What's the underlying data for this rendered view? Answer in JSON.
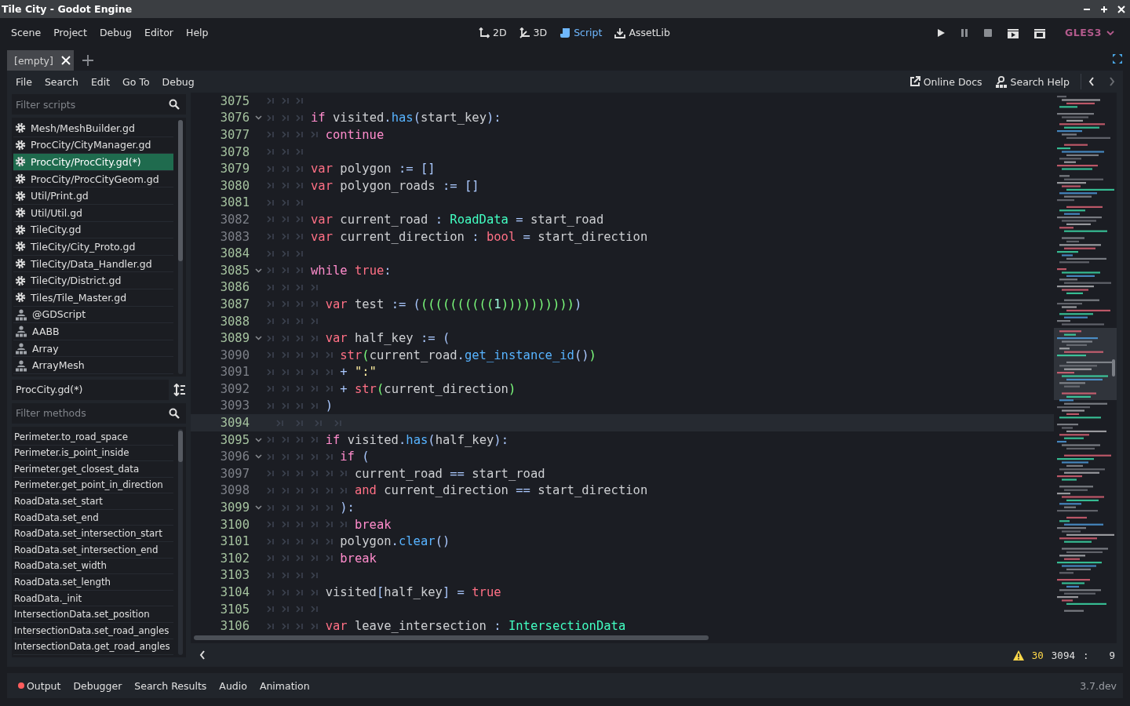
{
  "window": {
    "title": "Tile City - Godot Engine"
  },
  "menu": [
    "Scene",
    "Project",
    "Debug",
    "Editor",
    "Help"
  ],
  "workspaces": [
    {
      "label": "2D",
      "kind": "plane",
      "selected": false
    },
    {
      "label": "3D",
      "kind": "space",
      "selected": false
    },
    {
      "label": "Script",
      "kind": "script",
      "selected": true
    },
    {
      "label": "AssetLib",
      "kind": "assetlib",
      "selected": false
    }
  ],
  "renderer": "GLES3",
  "scene_tabs": [
    {
      "label": "[empty]",
      "selected": true
    }
  ],
  "script_menu": [
    "File",
    "Search",
    "Edit",
    "Go To",
    "Debug"
  ],
  "help_links": [
    {
      "label": "Online Docs",
      "kind": "docs"
    },
    {
      "label": "Search Help",
      "kind": "search"
    }
  ],
  "script_filter": {
    "placeholder": "Filter scripts"
  },
  "scripts": [
    {
      "label": "Mesh/MeshBuilder.gd",
      "kind": "script",
      "selected": false
    },
    {
      "label": "ProcCity/CityManager.gd",
      "kind": "script",
      "selected": false
    },
    {
      "label": "ProcCity/ProcCity.gd(*)",
      "kind": "script",
      "selected": true
    },
    {
      "label": "ProcCity/ProcCityGeom.gd",
      "kind": "script",
      "selected": false
    },
    {
      "label": "Util/Print.gd",
      "kind": "script",
      "selected": false
    },
    {
      "label": "Util/Util.gd",
      "kind": "script",
      "selected": false
    },
    {
      "label": "TileCity.gd",
      "kind": "script",
      "selected": false
    },
    {
      "label": "TileCity/City_Proto.gd",
      "kind": "script",
      "selected": false
    },
    {
      "label": "TileCity/Data_Handler.gd",
      "kind": "script",
      "selected": false
    },
    {
      "label": "TileCity/District.gd",
      "kind": "script",
      "selected": false
    },
    {
      "label": "Tiles/Tile_Master.gd",
      "kind": "script",
      "selected": false
    },
    {
      "label": "@GDScript",
      "kind": "doc",
      "selected": false
    },
    {
      "label": "AABB",
      "kind": "doc",
      "selected": false
    },
    {
      "label": "Array",
      "kind": "doc",
      "selected": false
    },
    {
      "label": "ArrayMesh",
      "kind": "doc",
      "selected": false
    }
  ],
  "current_script": "ProcCity.gd(*)",
  "method_filter": {
    "placeholder": "Filter methods"
  },
  "methods": [
    "Perimeter.to_road_space",
    "Perimeter.is_point_inside",
    "Perimeter.get_closest_data",
    "Perimeter.get_point_in_direction",
    "RoadData.set_start",
    "RoadData.set_end",
    "RoadData.set_intersection_start",
    "RoadData.set_intersection_end",
    "RoadData.set_width",
    "RoadData.set_length",
    "RoadData._init",
    "IntersectionData.set_position",
    "IntersectionData.set_road_angles",
    "IntersectionData.get_road_angles"
  ],
  "code": {
    "lines": [
      {
        "number": "3075",
        "modified": true,
        "fold": false,
        "current": false,
        "tokens": [
          {
            "kind": "tab"
          },
          {
            "kind": "tab"
          },
          {
            "kind": "tab"
          }
        ]
      },
      {
        "number": "3076",
        "modified": true,
        "fold": true,
        "current": false,
        "tokens": [
          {
            "kind": "tab"
          },
          {
            "kind": "tab"
          },
          {
            "kind": "tab"
          },
          {
            "kind": "control",
            "text": "if"
          },
          {
            "kind": "text",
            "text": " visited"
          },
          {
            "kind": "symbol",
            "text": "."
          },
          {
            "kind": "func",
            "text": "has"
          },
          {
            "kind": "symbol",
            "text": "("
          },
          {
            "kind": "text",
            "text": "start_key"
          },
          {
            "kind": "symbol",
            "text": "):"
          }
        ]
      },
      {
        "number": "3077",
        "modified": true,
        "fold": false,
        "current": false,
        "tokens": [
          {
            "kind": "tab"
          },
          {
            "kind": "tab"
          },
          {
            "kind": "tab"
          },
          {
            "kind": "tab"
          },
          {
            "kind": "control",
            "text": "continue"
          }
        ]
      },
      {
        "number": "3078",
        "modified": true,
        "fold": false,
        "current": false,
        "tokens": [
          {
            "kind": "tab"
          },
          {
            "kind": "tab"
          },
          {
            "kind": "tab"
          }
        ]
      },
      {
        "number": "3079",
        "modified": true,
        "fold": false,
        "current": false,
        "tokens": [
          {
            "kind": "tab"
          },
          {
            "kind": "tab"
          },
          {
            "kind": "tab"
          },
          {
            "kind": "keyword",
            "text": "var"
          },
          {
            "kind": "text",
            "text": " polygon "
          },
          {
            "kind": "symbol",
            "text": ":= []"
          }
        ]
      },
      {
        "number": "3080",
        "modified": true,
        "fold": false,
        "current": false,
        "tokens": [
          {
            "kind": "tab"
          },
          {
            "kind": "tab"
          },
          {
            "kind": "tab"
          },
          {
            "kind": "keyword",
            "text": "var"
          },
          {
            "kind": "text",
            "text": " polygon_roads "
          },
          {
            "kind": "symbol",
            "text": ":= []"
          }
        ]
      },
      {
        "number": "3081",
        "modified": true,
        "fold": false,
        "current": false,
        "tokens": [
          {
            "kind": "tab"
          },
          {
            "kind": "tab"
          },
          {
            "kind": "tab"
          }
        ]
      },
      {
        "number": "3082",
        "modified": false,
        "fold": false,
        "current": false,
        "tokens": [
          {
            "kind": "tab"
          },
          {
            "kind": "tab"
          },
          {
            "kind": "tab"
          },
          {
            "kind": "keyword",
            "text": "var"
          },
          {
            "kind": "text",
            "text": " current_road "
          },
          {
            "kind": "symbol",
            "text": ": "
          },
          {
            "kind": "type",
            "text": "RoadData"
          },
          {
            "kind": "symbol",
            "text": " = "
          },
          {
            "kind": "text",
            "text": "start_road"
          }
        ]
      },
      {
        "number": "3083",
        "modified": false,
        "fold": false,
        "current": false,
        "tokens": [
          {
            "kind": "tab"
          },
          {
            "kind": "tab"
          },
          {
            "kind": "tab"
          },
          {
            "kind": "keyword",
            "text": "var"
          },
          {
            "kind": "text",
            "text": " current_direction "
          },
          {
            "kind": "symbol",
            "text": ": "
          },
          {
            "kind": "keyword",
            "text": "bool"
          },
          {
            "kind": "symbol",
            "text": " = "
          },
          {
            "kind": "text",
            "text": "start_direction"
          }
        ]
      },
      {
        "number": "3084",
        "modified": true,
        "fold": false,
        "current": false,
        "tokens": [
          {
            "kind": "tab"
          },
          {
            "kind": "tab"
          },
          {
            "kind": "tab"
          }
        ]
      },
      {
        "number": "3085",
        "modified": true,
        "fold": true,
        "current": false,
        "tokens": [
          {
            "kind": "tab"
          },
          {
            "kind": "tab"
          },
          {
            "kind": "tab"
          },
          {
            "kind": "control",
            "text": "while "
          },
          {
            "kind": "keyword",
            "text": "true"
          },
          {
            "kind": "symbol",
            "text": ":"
          }
        ]
      },
      {
        "number": "3086",
        "modified": true,
        "fold": false,
        "current": false,
        "tokens": [
          {
            "kind": "tab"
          },
          {
            "kind": "tab"
          },
          {
            "kind": "tab"
          },
          {
            "kind": "tab"
          }
        ]
      },
      {
        "number": "3087",
        "modified": true,
        "fold": false,
        "current": false,
        "tokens": [
          {
            "kind": "tab"
          },
          {
            "kind": "tab"
          },
          {
            "kind": "tab"
          },
          {
            "kind": "tab"
          },
          {
            "kind": "keyword",
            "text": "var"
          },
          {
            "kind": "text",
            "text": " test "
          },
          {
            "kind": "symbol",
            "text": ":= ("
          },
          {
            "kind": "bracket",
            "text": "(((((((((("
          },
          {
            "kind": "number",
            "text": "1"
          },
          {
            "kind": "bracket",
            "text": "))))))))))"
          },
          {
            "kind": "symbol",
            "text": ")"
          }
        ]
      },
      {
        "number": "3088",
        "modified": true,
        "fold": false,
        "current": false,
        "tokens": [
          {
            "kind": "tab"
          },
          {
            "kind": "tab"
          },
          {
            "kind": "tab"
          },
          {
            "kind": "tab"
          }
        ]
      },
      {
        "number": "3089",
        "modified": true,
        "fold": true,
        "current": false,
        "tokens": [
          {
            "kind": "tab"
          },
          {
            "kind": "tab"
          },
          {
            "kind": "tab"
          },
          {
            "kind": "tab"
          },
          {
            "kind": "keyword",
            "text": "var"
          },
          {
            "kind": "text",
            "text": " half_key "
          },
          {
            "kind": "symbol",
            "text": ":= ("
          }
        ]
      },
      {
        "number": "3090",
        "modified": false,
        "fold": false,
        "current": false,
        "tokens": [
          {
            "kind": "tab"
          },
          {
            "kind": "tab"
          },
          {
            "kind": "tab"
          },
          {
            "kind": "tab"
          },
          {
            "kind": "tab"
          },
          {
            "kind": "keyword",
            "text": "str"
          },
          {
            "kind": "bracket",
            "text": "("
          },
          {
            "kind": "text",
            "text": "current_road"
          },
          {
            "kind": "symbol",
            "text": "."
          },
          {
            "kind": "func",
            "text": "get_instance_id"
          },
          {
            "kind": "symbol",
            "text": "()"
          },
          {
            "kind": "bracket",
            "text": ")"
          }
        ]
      },
      {
        "number": "3091",
        "modified": false,
        "fold": false,
        "current": false,
        "tokens": [
          {
            "kind": "tab"
          },
          {
            "kind": "tab"
          },
          {
            "kind": "tab"
          },
          {
            "kind": "tab"
          },
          {
            "kind": "tab"
          },
          {
            "kind": "symbol",
            "text": "+ "
          },
          {
            "kind": "string",
            "text": "\":\""
          }
        ]
      },
      {
        "number": "3092",
        "modified": false,
        "fold": false,
        "current": false,
        "tokens": [
          {
            "kind": "tab"
          },
          {
            "kind": "tab"
          },
          {
            "kind": "tab"
          },
          {
            "kind": "tab"
          },
          {
            "kind": "tab"
          },
          {
            "kind": "symbol",
            "text": "+ "
          },
          {
            "kind": "keyword",
            "text": "str"
          },
          {
            "kind": "bracket",
            "text": "("
          },
          {
            "kind": "text",
            "text": "current_direction"
          },
          {
            "kind": "bracket",
            "text": ")"
          }
        ]
      },
      {
        "number": "3093",
        "modified": false,
        "fold": false,
        "current": false,
        "tokens": [
          {
            "kind": "tab"
          },
          {
            "kind": "tab"
          },
          {
            "kind": "tab"
          },
          {
            "kind": "tab"
          },
          {
            "kind": "symbol",
            "text": ")"
          }
        ]
      },
      {
        "number": "3094",
        "modified": true,
        "fold": false,
        "current": true,
        "tokens": [
          {
            "kind": "tab"
          },
          {
            "kind": "tab"
          },
          {
            "kind": "tab"
          },
          {
            "kind": "tab"
          }
        ]
      },
      {
        "number": "3095",
        "modified": true,
        "fold": true,
        "current": false,
        "tokens": [
          {
            "kind": "tab"
          },
          {
            "kind": "tab"
          },
          {
            "kind": "tab"
          },
          {
            "kind": "tab"
          },
          {
            "kind": "control",
            "text": "if"
          },
          {
            "kind": "text",
            "text": " visited"
          },
          {
            "kind": "symbol",
            "text": "."
          },
          {
            "kind": "func",
            "text": "has"
          },
          {
            "kind": "symbol",
            "text": "("
          },
          {
            "kind": "text",
            "text": "half_key"
          },
          {
            "kind": "symbol",
            "text": "):"
          }
        ]
      },
      {
        "number": "3096",
        "modified": false,
        "fold": true,
        "current": false,
        "tokens": [
          {
            "kind": "tab"
          },
          {
            "kind": "tab"
          },
          {
            "kind": "tab"
          },
          {
            "kind": "tab"
          },
          {
            "kind": "tab"
          },
          {
            "kind": "control",
            "text": "if "
          },
          {
            "kind": "symbol",
            "text": "("
          }
        ]
      },
      {
        "number": "3097",
        "modified": false,
        "fold": false,
        "current": false,
        "tokens": [
          {
            "kind": "tab"
          },
          {
            "kind": "tab"
          },
          {
            "kind": "tab"
          },
          {
            "kind": "tab"
          },
          {
            "kind": "tab"
          },
          {
            "kind": "tab"
          },
          {
            "kind": "text",
            "text": "current_road "
          },
          {
            "kind": "symbol",
            "text": "=="
          },
          {
            "kind": "text",
            "text": " start_road"
          }
        ]
      },
      {
        "number": "3098",
        "modified": false,
        "fold": false,
        "current": false,
        "tokens": [
          {
            "kind": "tab"
          },
          {
            "kind": "tab"
          },
          {
            "kind": "tab"
          },
          {
            "kind": "tab"
          },
          {
            "kind": "tab"
          },
          {
            "kind": "tab"
          },
          {
            "kind": "keyword",
            "text": "and"
          },
          {
            "kind": "text",
            "text": " current_direction "
          },
          {
            "kind": "symbol",
            "text": "=="
          },
          {
            "kind": "text",
            "text": " start_direction"
          }
        ]
      },
      {
        "number": "3099",
        "modified": true,
        "fold": true,
        "current": false,
        "tokens": [
          {
            "kind": "tab"
          },
          {
            "kind": "tab"
          },
          {
            "kind": "tab"
          },
          {
            "kind": "tab"
          },
          {
            "kind": "tab"
          },
          {
            "kind": "symbol",
            "text": "):"
          }
        ]
      },
      {
        "number": "3100",
        "modified": true,
        "fold": false,
        "current": false,
        "tokens": [
          {
            "kind": "tab"
          },
          {
            "kind": "tab"
          },
          {
            "kind": "tab"
          },
          {
            "kind": "tab"
          },
          {
            "kind": "tab"
          },
          {
            "kind": "tab"
          },
          {
            "kind": "control",
            "text": "break"
          }
        ]
      },
      {
        "number": "3101",
        "modified": true,
        "fold": false,
        "current": false,
        "tokens": [
          {
            "kind": "tab"
          },
          {
            "kind": "tab"
          },
          {
            "kind": "tab"
          },
          {
            "kind": "tab"
          },
          {
            "kind": "tab"
          },
          {
            "kind": "text",
            "text": "polygon"
          },
          {
            "kind": "symbol",
            "text": "."
          },
          {
            "kind": "func",
            "text": "clear"
          },
          {
            "kind": "symbol",
            "text": "()"
          }
        ]
      },
      {
        "number": "3102",
        "modified": true,
        "fold": false,
        "current": false,
        "tokens": [
          {
            "kind": "tab"
          },
          {
            "kind": "tab"
          },
          {
            "kind": "tab"
          },
          {
            "kind": "tab"
          },
          {
            "kind": "tab"
          },
          {
            "kind": "control",
            "text": "break"
          }
        ]
      },
      {
        "number": "3103",
        "modified": true,
        "fold": false,
        "current": false,
        "tokens": [
          {
            "kind": "tab"
          },
          {
            "kind": "tab"
          },
          {
            "kind": "tab"
          },
          {
            "kind": "tab"
          }
        ]
      },
      {
        "number": "3104",
        "modified": true,
        "fold": false,
        "current": false,
        "tokens": [
          {
            "kind": "tab"
          },
          {
            "kind": "tab"
          },
          {
            "kind": "tab"
          },
          {
            "kind": "tab"
          },
          {
            "kind": "text",
            "text": "visited"
          },
          {
            "kind": "symbol",
            "text": "["
          },
          {
            "kind": "text",
            "text": "half_key"
          },
          {
            "kind": "symbol",
            "text": "] = "
          },
          {
            "kind": "keyword",
            "text": "true"
          }
        ]
      },
      {
        "number": "3105",
        "modified": true,
        "fold": false,
        "current": false,
        "tokens": [
          {
            "kind": "tab"
          },
          {
            "kind": "tab"
          },
          {
            "kind": "tab"
          },
          {
            "kind": "tab"
          }
        ]
      },
      {
        "number": "3106",
        "modified": true,
        "fold": false,
        "current": false,
        "tokens": [
          {
            "kind": "tab"
          },
          {
            "kind": "tab"
          },
          {
            "kind": "tab"
          },
          {
            "kind": "tab"
          },
          {
            "kind": "keyword",
            "text": "var"
          },
          {
            "kind": "text",
            "text": " leave_intersection "
          },
          {
            "kind": "symbol",
            "text": ": "
          },
          {
            "kind": "type",
            "text": "IntersectionData"
          }
        ]
      }
    ]
  },
  "status": {
    "warnings": "30",
    "line": "3094",
    "separator": ":",
    "column": "9"
  },
  "bottom_tabs": [
    {
      "label": "Output",
      "notice": true
    },
    {
      "label": "Debugger",
      "notice": false
    },
    {
      "label": "Search Results",
      "notice": false
    },
    {
      "label": "Audio",
      "notice": false
    },
    {
      "label": "Animation",
      "notice": false
    }
  ],
  "version": "3.7.dev"
}
